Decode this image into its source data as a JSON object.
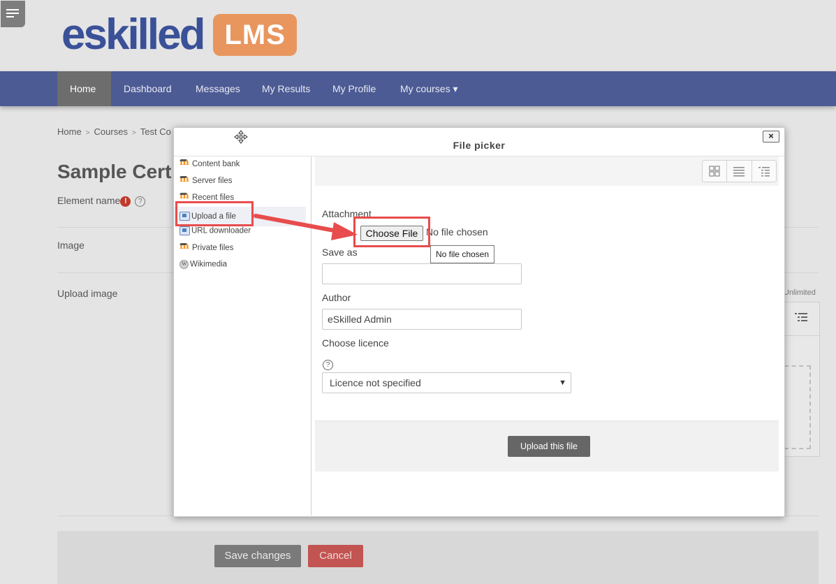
{
  "logo": {
    "main": "eskilled",
    "badge": "LMS"
  },
  "nav": {
    "items": [
      {
        "label": "Home",
        "active": true
      },
      {
        "label": "Dashboard"
      },
      {
        "label": "Messages"
      },
      {
        "label": "My Results"
      },
      {
        "label": "My Profile"
      },
      {
        "label": "My courses ▾"
      }
    ]
  },
  "breadcrumb": [
    "Home",
    "Courses",
    "Test Co"
  ],
  "page": {
    "title": "Sample Cert",
    "element_name_label": "Element name",
    "image_label": "Image",
    "upload_image_label": "Upload image",
    "unlimited": "Unlimited",
    "save_label": "Save changes",
    "cancel_label": "Cancel"
  },
  "file_picker": {
    "title": "File picker",
    "close": "×",
    "repositories": [
      {
        "label": "Content bank",
        "icon": "moodle-icon"
      },
      {
        "label": "Server files",
        "icon": "moodle-icon"
      },
      {
        "label": "Recent files",
        "icon": "moodle-icon"
      },
      {
        "label": "Upload a file",
        "icon": "upload-icon",
        "active": true
      },
      {
        "label": "URL downloader",
        "icon": "upload-icon"
      },
      {
        "label": "Private files",
        "icon": "moodle-icon"
      },
      {
        "label": "Wikimedia",
        "icon": "wikimedia-icon"
      }
    ],
    "attachment_label": "Attachment",
    "choose_file_label": "Choose File",
    "no_file_text": "No file chosen",
    "tooltip": "No file chosen",
    "save_as_label": "Save as",
    "save_as_value": "",
    "author_label": "Author",
    "author_value": "eSkilled Admin",
    "licence_label": "Choose licence",
    "licence_value": "Licence not specified",
    "upload_button": "Upload this file"
  },
  "colors": {
    "nav": "#4c5b94",
    "highlight": "#e84c4c",
    "cancel": "#c25451"
  }
}
